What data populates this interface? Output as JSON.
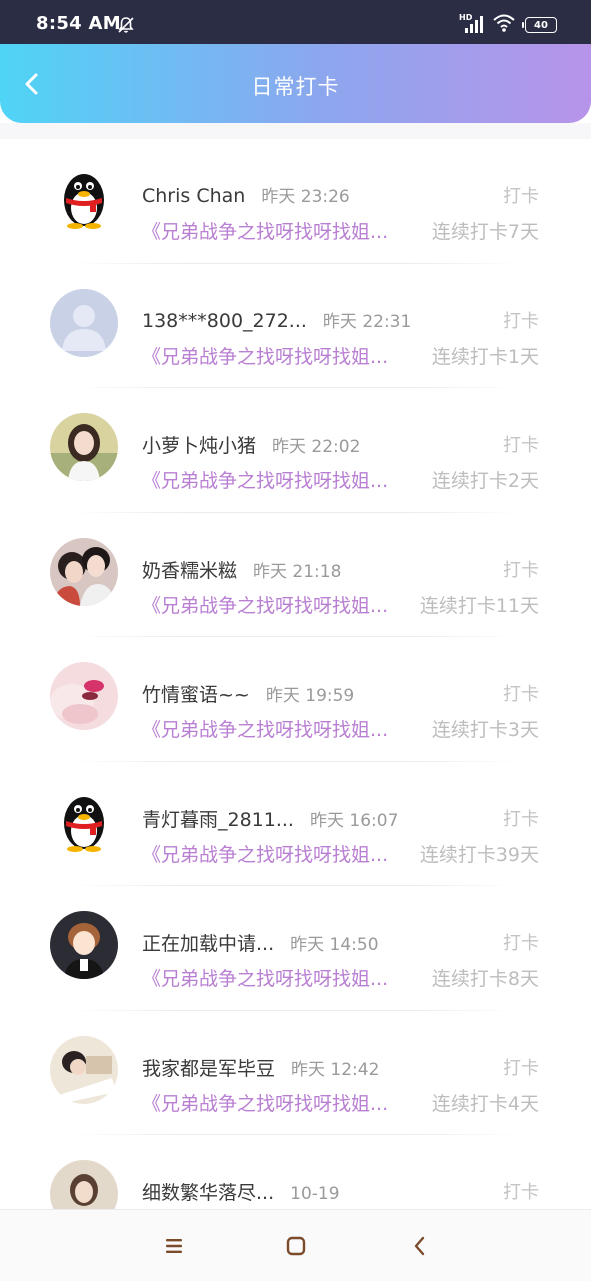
{
  "status": {
    "time": "8:54 AM",
    "battery": "40",
    "network": "HD"
  },
  "header": {
    "title": "日常打卡"
  },
  "rows": [
    {
      "name": "Chris Chan",
      "time": "昨天 23:26",
      "action": "打卡",
      "topic": "《兄弟战争之找呀找呀找姐...",
      "streak": "连续打卡7天",
      "avatar": "qq-penguin"
    },
    {
      "name": "138***800_272...",
      "time": "昨天 22:31",
      "action": "打卡",
      "topic": "《兄弟战争之找呀找呀找姐...",
      "streak": "连续打卡1天",
      "avatar": "default-person"
    },
    {
      "name": "小萝卜炖小猪",
      "time": "昨天 22:02",
      "action": "打卡",
      "topic": "《兄弟战争之找呀找呀找姐...",
      "streak": "连续打卡2天",
      "avatar": "girl-photo"
    },
    {
      "name": "奶香糯米糍",
      "time": "昨天 21:18",
      "action": "打卡",
      "topic": "《兄弟战争之找呀找呀找姐...",
      "streak": "连续打卡11天",
      "avatar": "boys-photo"
    },
    {
      "name": "竹情蜜语~~",
      "time": "昨天 19:59",
      "action": "打卡",
      "topic": "《兄弟战争之找呀找呀找姐...",
      "streak": "连续打卡3天",
      "avatar": "pink-photo"
    },
    {
      "name": "青灯暮雨_2811...",
      "time": "昨天 16:07",
      "action": "打卡",
      "topic": "《兄弟战争之找呀找呀找姐...",
      "streak": "连续打卡39天",
      "avatar": "qq-penguin"
    },
    {
      "name": "正在加载中请...",
      "time": "昨天 14:50",
      "action": "打卡",
      "topic": "《兄弟战争之找呀找呀找姐...",
      "streak": "连续打卡8天",
      "avatar": "anime-boy"
    },
    {
      "name": "我家都是军毕豆",
      "time": "昨天 12:42",
      "action": "打卡",
      "topic": "《兄弟战争之找呀找呀找姐...",
      "streak": "连续打卡4天",
      "avatar": "sleep-photo"
    },
    {
      "name": "细数繁华落尽...",
      "time": "10-19",
      "action": "打卡",
      "topic": "",
      "streak": "",
      "avatar": "girl2-photo"
    }
  ],
  "colors": {
    "header_start": "#4fd4f6",
    "header_end": "#b794ea",
    "topic": "#b97fd3",
    "status_bg": "#2b2d45"
  }
}
